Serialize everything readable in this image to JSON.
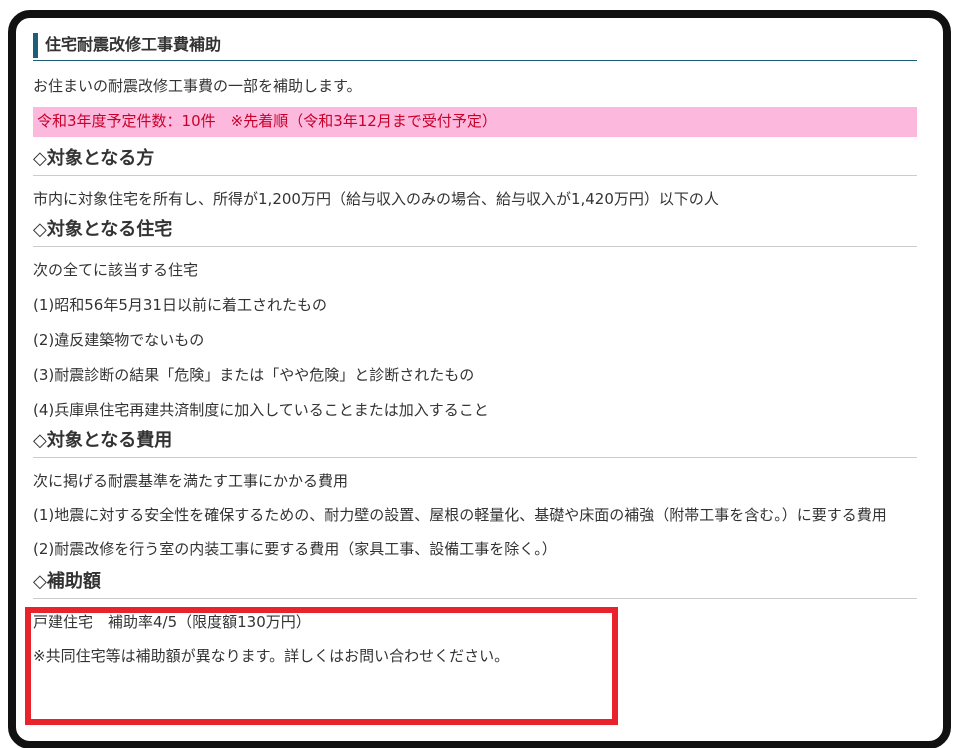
{
  "section": {
    "title": "住宅耐震改修工事費補助",
    "intro": "お住まいの耐震改修工事費の一部を補助します。",
    "notice": "令和3年度予定件数：10件　※先着順（令和3年12月まで受付予定）"
  },
  "target_person": {
    "heading": "◇対象となる方",
    "text": "市内に対象住宅を所有し、所得が1,200万円（給与収入のみの場合、給与収入が1,420万円）以下の人"
  },
  "target_house": {
    "heading": "◇対象となる住宅",
    "lead": "次の全てに該当する住宅",
    "items": [
      "(1)昭和56年5月31日以前に着工されたもの",
      "(2)違反建築物でないもの",
      "(3)耐震診断の結果「危険」または「やや危険」と診断されたもの",
      "(4)兵庫県住宅再建共済制度に加入していることまたは加入すること"
    ]
  },
  "target_cost": {
    "heading": "◇対象となる費用",
    "lead": "次に掲げる耐震基準を満たす工事にかかる費用",
    "items": [
      "(1)地震に対する安全性を確保するための、耐力壁の設置、屋根の軽量化、基礎や床面の補強（附帯工事を含む。）に要する費用",
      "(2)耐震改修を行う室の内装工事に要する費用（家具工事、設備工事を除く。）"
    ]
  },
  "subsidy": {
    "heading": "◇補助額",
    "line1": "戸建住宅　補助率4/5（限度額130万円）",
    "line2": "※共同住宅等は補助額が異なります。詳しくはお問い合わせください。"
  },
  "colors": {
    "accent": "#1d5f7a",
    "notice_bg": "#fdb8dd",
    "notice_text": "#c8002a",
    "highlight_border": "#e8232e"
  }
}
